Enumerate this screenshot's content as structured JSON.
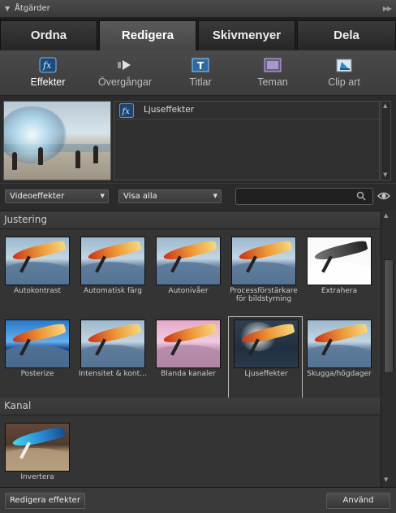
{
  "panel": {
    "title": "Åtgärder"
  },
  "tabs": [
    {
      "label": "Ordna"
    },
    {
      "label": "Redigera"
    },
    {
      "label": "Skivmenyer"
    },
    {
      "label": "Dela"
    }
  ],
  "subtabs": [
    {
      "label": "Effekter",
      "icon": "fx-icon"
    },
    {
      "label": "Övergångar",
      "icon": "transition-arrow-icon"
    },
    {
      "label": "Titlar",
      "icon": "title-t-icon"
    },
    {
      "label": "Teman",
      "icon": "theme-icon"
    },
    {
      "label": "Clip art",
      "icon": "clip-art-icon"
    }
  ],
  "applied": {
    "items": [
      {
        "label": "Ljuseffekter",
        "icon": "fx-icon"
      }
    ]
  },
  "filters": {
    "category": "Videoeffekter",
    "show": "Visa alla",
    "search_placeholder": ""
  },
  "sections": [
    {
      "title": "Justering",
      "items": [
        {
          "label": "Autokontrast"
        },
        {
          "label": "Automatisk färg"
        },
        {
          "label": "Autonivåer"
        },
        {
          "label": "Processförstärkare för bildstyrning"
        },
        {
          "label": "Extrahera"
        },
        {
          "label": "Posterize"
        },
        {
          "label": "Intensitet & kont…"
        },
        {
          "label": "Blanda kanaler"
        },
        {
          "label": "Ljuseffekter",
          "selected": true
        },
        {
          "label": "Skugga/högdager"
        }
      ]
    },
    {
      "title": "Kanal",
      "items": [
        {
          "label": "Invertera"
        }
      ]
    }
  ],
  "footer": {
    "edit_label": "Redigera effekter",
    "apply_label": "Använd"
  }
}
